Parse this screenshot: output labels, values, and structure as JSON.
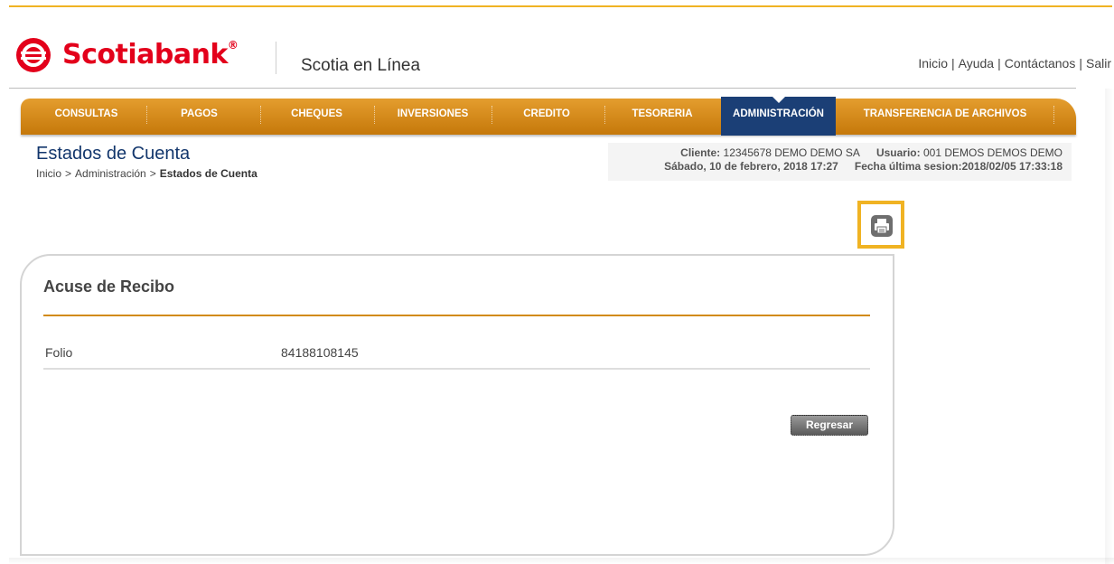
{
  "header": {
    "brand": "Scotiabank",
    "registered": "®",
    "product": "Scotia en Línea",
    "links": [
      "Inicio",
      "Ayuda",
      "Contáctanos",
      "Salir"
    ]
  },
  "nav": {
    "items": [
      "CONSULTAS",
      "PAGOS",
      "CHEQUES",
      "INVERSIONES",
      "CREDITO",
      "TESORERIA",
      "ADMINISTRACIÓN",
      "TRANSFERENCIA DE ARCHIVOS"
    ],
    "active": "ADMINISTRACIÓN"
  },
  "page": {
    "title": "Estados de Cuenta",
    "breadcrumb": [
      "Inicio",
      "Administración",
      "Estados de Cuenta"
    ],
    "breadcrumb_sep": ">"
  },
  "session": {
    "client_label": "Cliente:",
    "client_value": "12345678 DEMO DEMO SA",
    "user_label": "Usuario:",
    "user_value": "001 DEMOS DEMOS DEMO",
    "date": "Sábado, 10 de febrero, 2018 17:27",
    "last_session_label": "Fecha última sesion:",
    "last_session_value": "2018/02/05 17:33:18"
  },
  "receipt": {
    "title": "Acuse de Recibo",
    "folio_label": "Folio",
    "folio_value": "84188108145",
    "back_button": "Regresar"
  },
  "icons": {
    "logo": "scotiabank-logo",
    "print": "print-icon"
  },
  "colors": {
    "brand_red": "#e3001b",
    "nav_orange": "#d8891c",
    "nav_active": "#1b3f76",
    "highlight": "#f0b323"
  }
}
